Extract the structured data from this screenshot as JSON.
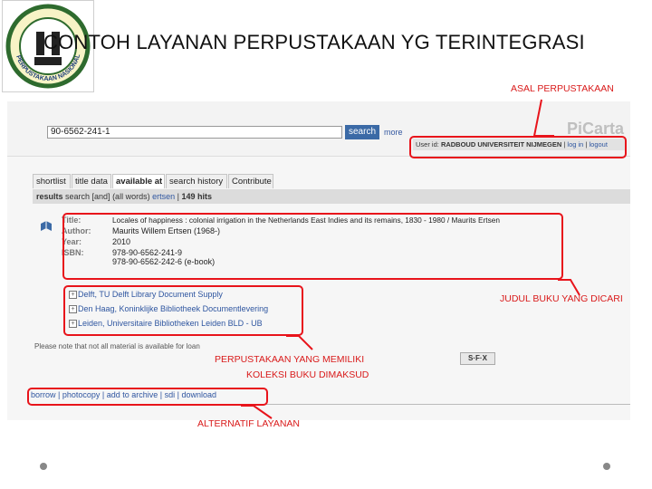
{
  "slide": {
    "title": "CONTOH LAYANAN PERPUSTAKAAN YG TERINTEGRASI",
    "logo_text": "PERPUSTAKAAN NASIONAL"
  },
  "catalog": {
    "search_value": "90-6562-241-1",
    "search_button": "search",
    "more_link": "more",
    "brand": "PiCarta",
    "user_label": "User id:",
    "user_value": "RADBOUD UNIVERSITEIT NIJMEGEN",
    "login_link": "log in",
    "logout_link": "logout",
    "tabs": [
      "shortlist",
      "title data",
      "available at",
      "search history",
      "Contribute"
    ],
    "results": {
      "label": "results",
      "query": "search [and] (all words)",
      "term": "ertsen",
      "hits": "149 hits"
    },
    "record": {
      "title_label": "Title:",
      "title_value": "Locales of happiness : colonial irrigation in the Netherlands East Indies and its remains, 1830 - 1980 / Maurits Ertsen",
      "author_label": "Author:",
      "author_value": "Maurits Willem Ertsen (1968-)",
      "year_label": "Year:",
      "year_value": "2010",
      "isbn_label": "ISBN:",
      "isbn_1": "978-90-6562-241-9",
      "isbn_2": "978-90-6562-242-6 (e-book)"
    },
    "libraries": [
      "Delft, TU Delft Library Document Supply",
      "Den Haag, Koninklijke Bibliotheek Documentlevering",
      "Leiden, Universitaire Bibliotheken Leiden BLD - UB"
    ],
    "note": "Please note that not all material is available for loan",
    "sfx_label": "S·F·X",
    "actions": "borrow | photocopy | add to archive | sdi | download"
  },
  "callouts": {
    "asal": "ASAL PERPUSTAKAAN",
    "judul": "JUDUL BUKU YANG DICARI",
    "memiliki_1": "PERPUSTAKAAN YANG MEMILIKI",
    "memiliki_2": "KOLEKSI BUKU DIMAKSUD",
    "alternatif": "ALTERNATIF LAYANAN"
  },
  "colors": {
    "highlight": "#e8141b",
    "link": "#2f56a0",
    "search_button": "#3b6aa6"
  }
}
